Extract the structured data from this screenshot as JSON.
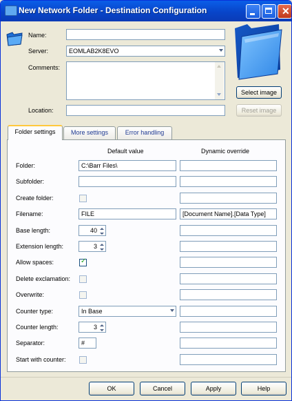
{
  "window": {
    "title": "New Network Folder - Destination Configuration",
    "buttons": [
      "minimize",
      "maximize",
      "close"
    ]
  },
  "header": {
    "name_label": "Name:",
    "name_value": "",
    "server_label": "Server:",
    "server_value": "EOMLAB2K8EVO",
    "comments_label": "Comments:",
    "comments_value": "",
    "location_label": "Location:",
    "location_value": "",
    "select_image_label": "Select image",
    "reset_image_label": "Reset image"
  },
  "tabs": [
    {
      "label": "Folder settings",
      "active": true
    },
    {
      "label": "More settings",
      "active": false
    },
    {
      "label": "Error handling",
      "active": false
    }
  ],
  "columns": {
    "default": "Default value",
    "dynamic": "Dynamic override"
  },
  "rows": [
    {
      "label": "Folder:",
      "type": "text",
      "value": "C:\\Barr Files\\",
      "override": ""
    },
    {
      "label": "Subfolder:",
      "type": "text",
      "value": "",
      "override": ""
    },
    {
      "label": "Create folder:",
      "type": "checkbox",
      "checked": false,
      "override": ""
    },
    {
      "label": "Filename:",
      "type": "text",
      "value": "FILE",
      "override": "[Document Name].[Data Type]"
    },
    {
      "label": "Base length:",
      "type": "spinner",
      "value": "40",
      "override": ""
    },
    {
      "label": "Extension length:",
      "type": "spinner",
      "value": "3",
      "override": ""
    },
    {
      "label": "Allow spaces:",
      "type": "checkbox",
      "checked": true,
      "override": ""
    },
    {
      "label": "Delete exclamation:",
      "type": "checkbox",
      "checked": false,
      "override": ""
    },
    {
      "label": "Overwrite:",
      "type": "checkbox",
      "checked": false,
      "override": ""
    },
    {
      "label": "Counter type:",
      "type": "dropdown",
      "value": "In Base",
      "override": ""
    },
    {
      "label": "Counter length:",
      "type": "spinner",
      "value": "3",
      "override": ""
    },
    {
      "label": "Separator:",
      "type": "smalltext",
      "value": "#",
      "override": ""
    },
    {
      "label": "Start with counter:",
      "type": "checkbox",
      "checked": false,
      "override": ""
    }
  ],
  "footer": {
    "ok": "OK",
    "cancel": "Cancel",
    "apply": "Apply",
    "help": "Help"
  },
  "icons": {
    "title": "folder-icon",
    "header": "folder-icon",
    "preview": "folder-preview-image"
  }
}
